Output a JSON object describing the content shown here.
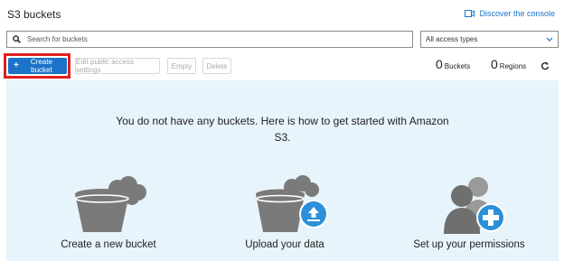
{
  "header": {
    "title": "S3 buckets",
    "discover_link": "Discover the console"
  },
  "search": {
    "placeholder": "Search for buckets",
    "filter_selected": "All access types"
  },
  "toolbar": {
    "create_label": "Create bucket",
    "edit_access_label": "Edit public access settings",
    "empty_label": "Empty",
    "delete_label": "Delete"
  },
  "stats": {
    "buckets_count": "0",
    "buckets_label": "Buckets",
    "regions_count": "0",
    "regions_label": "Regions"
  },
  "empty_state": {
    "line1": "You do not have any buckets. Here is how to get started with Amazon",
    "line2": "S3.",
    "features": [
      {
        "label": "Create a new bucket",
        "icon": "bucket-icon"
      },
      {
        "label": "Upload your data",
        "icon": "upload-bucket-icon"
      },
      {
        "label": "Set up your permissions",
        "icon": "permissions-icon"
      }
    ]
  },
  "colors": {
    "accent": "#1a73c9",
    "highlight": "#e02020",
    "panel_bg": "#e8f4fb",
    "icon_gray": "#7a7a7a",
    "icon_badge": "#2b90d9"
  }
}
